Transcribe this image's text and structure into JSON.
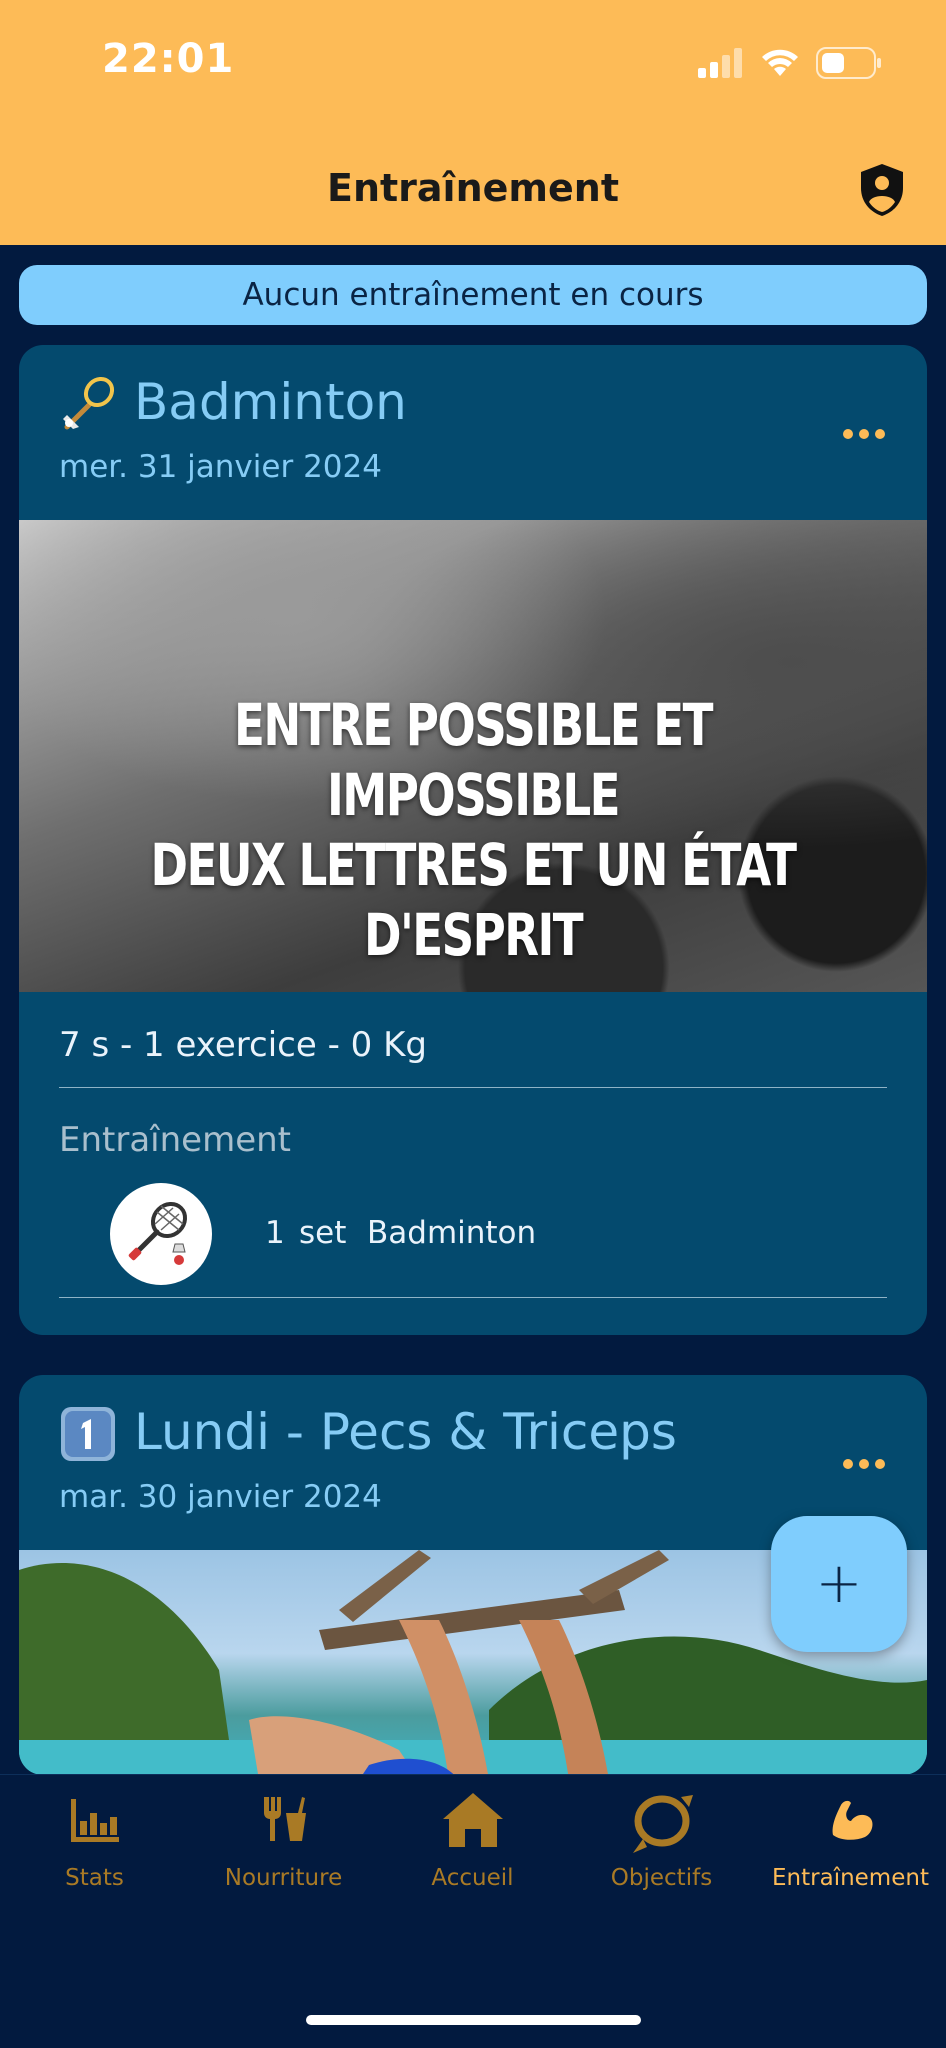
{
  "status_bar": {
    "time": "22:01"
  },
  "header": {
    "title": "Entraînement",
    "profile_icon": "shield-person-icon"
  },
  "banner": {
    "text": "Aucun entraînement en cours"
  },
  "workouts": [
    {
      "emoji": "badminton-emoji",
      "title": "Badminton",
      "date": "mer. 31 janvier 2024",
      "image_quote_line1": "ENTRE POSSIBLE ET IMPOSSIBLE",
      "image_quote_line2": "DEUX LETTRES ET UN ÉTAT D'ESPRIT",
      "summary": "7 s - 1 exercice - 0 Kg",
      "section_label": "Entraînement",
      "exercises": [
        {
          "count": "1",
          "unit": "set",
          "name": "Badminton",
          "icon": "badminton-racket-icon"
        }
      ]
    },
    {
      "emoji": "keycap-one-emoji",
      "title": "Lundi - Pecs & Triceps",
      "date": "mar. 30 janvier 2024"
    }
  ],
  "fab": {
    "label": "+"
  },
  "tabs": [
    {
      "label": "Stats",
      "icon": "stats-icon",
      "active": false
    },
    {
      "label": "Nourriture",
      "icon": "food-icon",
      "active": false
    },
    {
      "label": "Accueil",
      "icon": "home-icon",
      "active": false
    },
    {
      "label": "Objectifs",
      "icon": "goals-icon",
      "active": false
    },
    {
      "label": "Entraînement",
      "icon": "workout-icon",
      "active": true
    }
  ],
  "colors": {
    "header_bg": "#fdbb57",
    "page_bg": "#021a3f",
    "card_bg": "#044a6e",
    "accent_blue": "#7fcdfd",
    "tab_active": "#fdbb57",
    "tab_inactive": "#a97a25"
  }
}
